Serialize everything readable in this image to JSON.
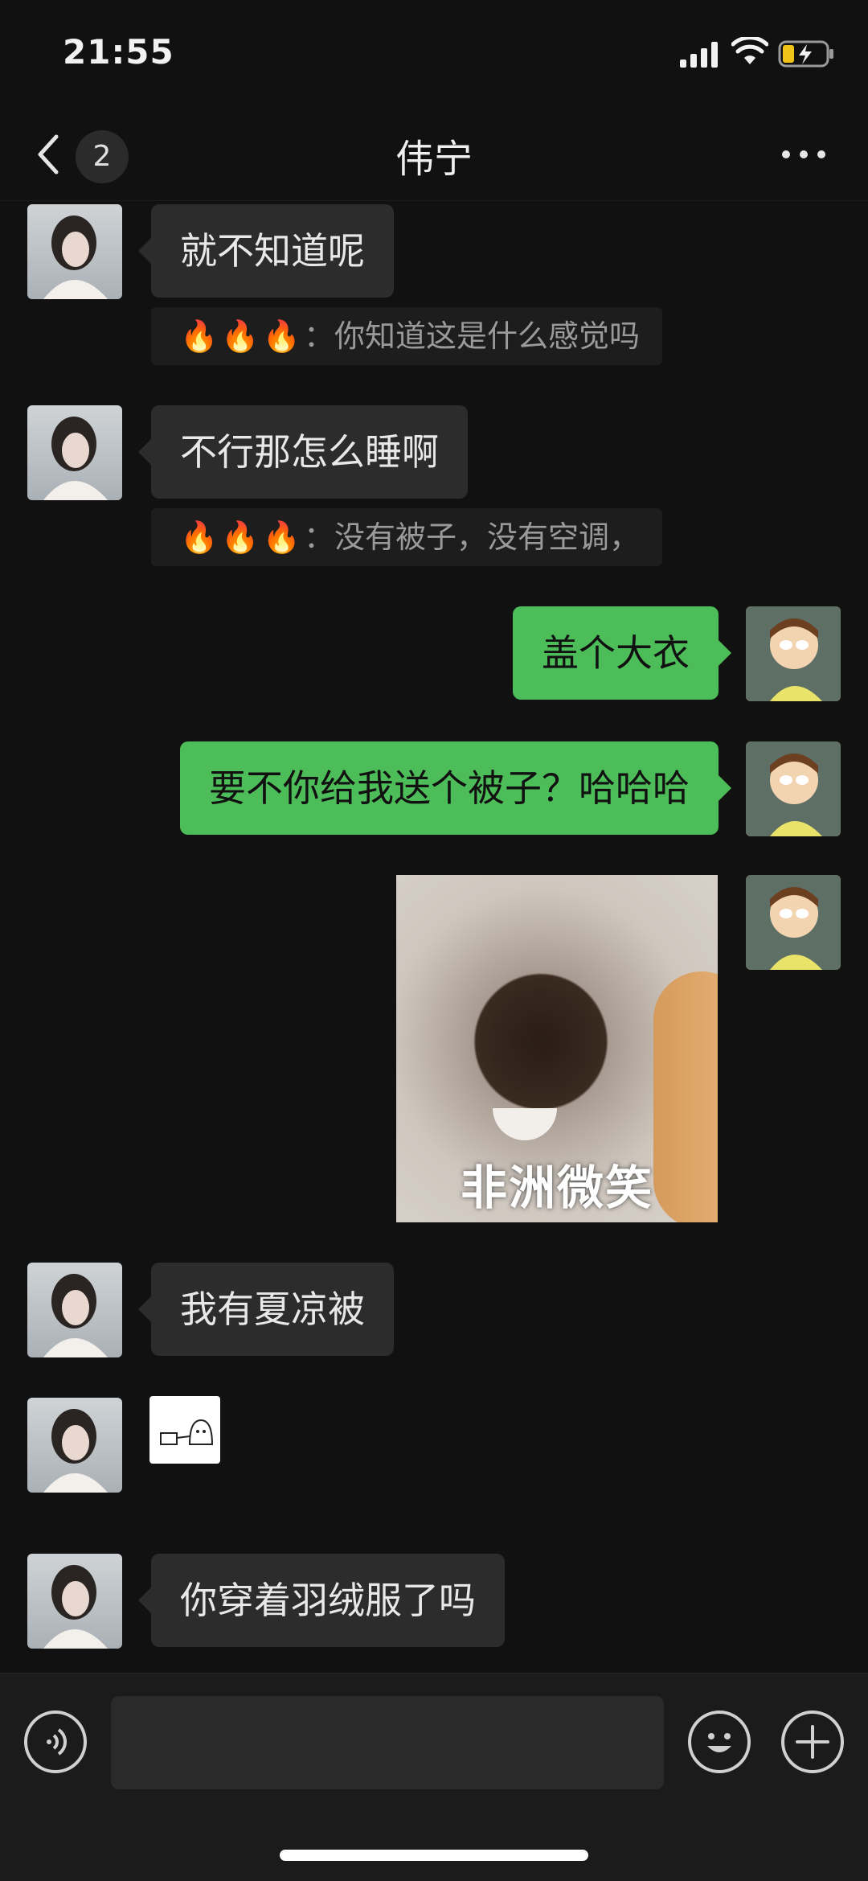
{
  "status_bar": {
    "time": "21:55"
  },
  "nav": {
    "unread_count": "2",
    "contact_name": "伟宁"
  },
  "messages": [
    {
      "side": "in",
      "text": "就不知道呢",
      "quote_prefix": "🔥🔥🔥",
      "quote_text": "：你知道这是什么感觉吗"
    },
    {
      "side": "in",
      "text": "不行那怎么睡啊",
      "quote_prefix": "🔥🔥🔥",
      "quote_text": "：没有被子，没有空调，"
    },
    {
      "side": "out",
      "text": "盖个大衣"
    },
    {
      "side": "out",
      "text": "要不你给我送个被子？哈哈哈"
    },
    {
      "side": "out",
      "sticker_caption": "非洲微笑"
    },
    {
      "side": "in",
      "text": "我有夏凉被"
    },
    {
      "side": "in",
      "sticker": "small-doodle"
    },
    {
      "side": "in",
      "text": "你穿着羽绒服了吗"
    }
  ],
  "input_bar": {
    "placeholder": "",
    "voice_icon": "voice-icon",
    "emoji_icon": "emoji-icon",
    "plus_icon": "plus-icon"
  },
  "colors": {
    "background": "#111111",
    "outgoing_bubble": "#4dbd5a",
    "incoming_bubble": "#2c2c2c"
  }
}
